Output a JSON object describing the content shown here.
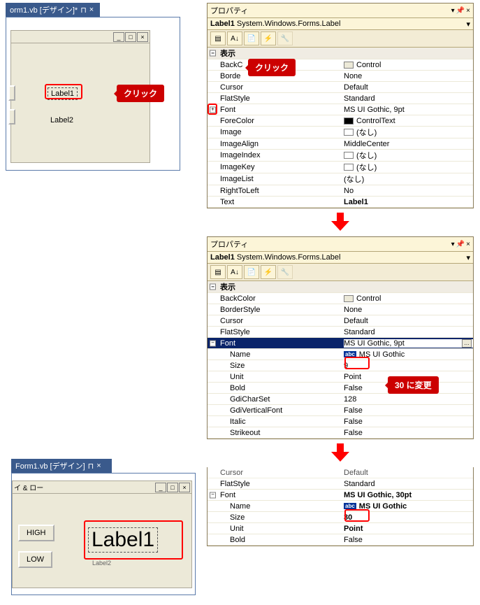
{
  "tab1": {
    "title": "orm1.vb [デザイン]*",
    "pin": "⊓",
    "close": "×"
  },
  "tab2": {
    "title": "Form1.vb [デザイン]",
    "pin": "⊓",
    "close": "×"
  },
  "form1": {
    "label1": "Label1",
    "label2": "Label2"
  },
  "callouts": {
    "click": "クリック",
    "change30": "30 に変更"
  },
  "props_header": {
    "title": "プロパティ"
  },
  "object_line": {
    "name": "Label1",
    "type": "System.Windows.Forms.Label"
  },
  "category1": "表示",
  "p1": {
    "BackColor": {
      "k": "BackC",
      "v": "Control"
    },
    "Border": {
      "k": "Borde",
      "v": "None"
    },
    "Cursor": {
      "k": "Cursor",
      "v": "Default"
    },
    "FlatStyle": {
      "k": "FlatStyle",
      "v": "Standard"
    },
    "Font": {
      "k": "Font",
      "v": "MS UI Gothic, 9pt"
    },
    "ForeColor": {
      "k": "ForeColor",
      "v": "ControlText"
    },
    "Image": {
      "k": "Image",
      "v": "(なし)"
    },
    "ImageAlign": {
      "k": "ImageAlign",
      "v": "MiddleCenter"
    },
    "ImageIndex": {
      "k": "ImageIndex",
      "v": "(なし)"
    },
    "ImageKey": {
      "k": "ImageKey",
      "v": "(なし)"
    },
    "ImageList": {
      "k": "ImageList",
      "v": "(なし)"
    },
    "RightToLeft": {
      "k": "RightToLeft",
      "v": "No"
    },
    "Text": {
      "k": "Text",
      "v": "Label1"
    }
  },
  "p2": {
    "BackColor": {
      "k": "BackColor",
      "v": "Control"
    },
    "BorderStyle": {
      "k": "BorderStyle",
      "v": "None"
    },
    "Cursor": {
      "k": "Cursor",
      "v": "Default"
    },
    "FlatStyle": {
      "k": "FlatStyle",
      "v": "Standard"
    },
    "Font": {
      "k": "Font",
      "v": "MS UI Gothic, 9pt"
    },
    "Name": {
      "k": "Name",
      "v": "MS UI Gothic"
    },
    "Size": {
      "k": "Size",
      "v": "9"
    },
    "Unit": {
      "k": "Unit",
      "v": "Point"
    },
    "Bold": {
      "k": "Bold",
      "v": "False"
    },
    "GdiCharSet": {
      "k": "GdiCharSet",
      "v": "128"
    },
    "GdiVerticalFont": {
      "k": "GdiVerticalFont",
      "v": "False"
    },
    "Italic": {
      "k": "Italic",
      "v": "False"
    },
    "Strikeout": {
      "k": "Strikeout",
      "v": "False"
    }
  },
  "p3": {
    "Cursor": {
      "k": "Cursor",
      "v": "Default"
    },
    "FlatStyle": {
      "k": "FlatStyle",
      "v": "Standard"
    },
    "Font": {
      "k": "Font",
      "v": "MS UI Gothic, 30pt"
    },
    "Name": {
      "k": "Name",
      "v": "MS UI Gothic"
    },
    "Size": {
      "k": "Size",
      "v": "30"
    },
    "Unit": {
      "k": "Unit",
      "v": "Point"
    },
    "Bold": {
      "k": "Bold",
      "v": "False"
    }
  },
  "form2": {
    "titlebar": "イ & ロー",
    "high": "HIGH",
    "low": "LOW",
    "biglabel": "Label1",
    "label2": "Label2"
  }
}
